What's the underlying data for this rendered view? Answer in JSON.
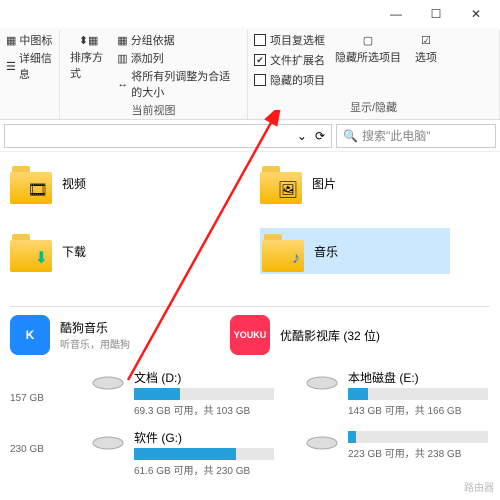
{
  "titlebar": {
    "min": "—",
    "max": "☐",
    "close": "✕"
  },
  "ribbon": {
    "layout": {
      "medium_icons": "中图标",
      "details": "详细信息"
    },
    "arrange": {
      "sort": "排序方式",
      "group_by": "分组依据",
      "add_column": "添加列",
      "fit_columns": "将所有列调整为合适的大小"
    },
    "current_view_label": "当前视图",
    "showhide": {
      "item_checkboxes": "项目复选框",
      "file_ext": "文件扩展名",
      "hidden_items": "隐藏的项目",
      "hide_selected": "隐藏所选项目",
      "options": "选项",
      "label": "显示/隐藏"
    }
  },
  "search": {
    "placeholder": "搜索\"此电脑\""
  },
  "folders": {
    "video": "视频",
    "pictures": "图片",
    "downloads": "下载",
    "music": "音乐"
  },
  "apps": {
    "kugou": {
      "title": "酷狗音乐",
      "sub": "听音乐，用酷狗",
      "badge": "K"
    },
    "youku": {
      "title": "优酷影视库 (32 位)",
      "badge": "YOUKU"
    }
  },
  "drives": {
    "c_left": {
      "free": "157 GB"
    },
    "c_left2": {
      "free": "230 GB"
    },
    "d": {
      "name": "文档 (D:)",
      "text": "69.3 GB 可用，共 103 GB",
      "pct": 33
    },
    "g": {
      "name": "软件 (G:)",
      "text": "61.6 GB 可用，共 230 GB",
      "pct": 73
    },
    "e": {
      "name": "本地磁盘 (E:)",
      "text": "143 GB 可用，共 166 GB",
      "pct": 14
    },
    "h": {
      "name": "",
      "text": "223 GB 可用，共 238 GB",
      "pct": 6
    }
  },
  "watermark": "路由器"
}
